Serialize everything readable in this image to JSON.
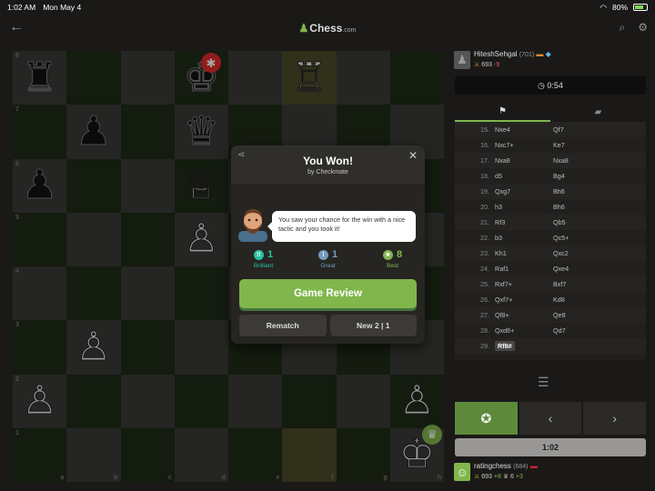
{
  "status_bar": {
    "time": "1:02 AM",
    "date": "Mon May 4",
    "battery": "80%"
  },
  "app": {
    "logo_main": "Chess",
    "logo_suffix": ".com"
  },
  "board": {
    "pieces": [
      [
        "♜",
        "",
        "",
        "♚",
        "",
        "♖",
        "",
        ""
      ],
      [
        "",
        "♟",
        "",
        "♛",
        "",
        "",
        "",
        ""
      ],
      [
        "♟",
        "",
        "",
        "♕",
        "",
        "",
        "",
        ""
      ],
      [
        "",
        "",
        "",
        "♙",
        "",
        "",
        "",
        ""
      ],
      [
        "",
        "",
        "",
        "",
        "",
        "",
        "",
        ""
      ],
      [
        "",
        "♙",
        "",
        "",
        "",
        "",
        "",
        ""
      ],
      [
        "♙",
        "",
        "",
        "",
        "",
        "",
        "",
        "♙"
      ],
      [
        "",
        "",
        "",
        "",
        "",
        "",
        "",
        "♔"
      ]
    ],
    "rank_labels": [
      "8",
      "7",
      "6",
      "5",
      "4",
      "3",
      "2",
      "1"
    ],
    "file_labels": [
      "a",
      "b",
      "c",
      "d",
      "e",
      "f",
      "g",
      "h"
    ]
  },
  "modal": {
    "title": "You Won!",
    "subtitle": "by Checkmate",
    "coach_message": "You saw your chance for the win with a nice tactic and you took it!",
    "stats": [
      {
        "icon": "!!",
        "value": "1",
        "label": "Brilliant",
        "color": "#26c2a3"
      },
      {
        "icon": "!",
        "value": "1",
        "label": "Great",
        "color": "#749bbf"
      },
      {
        "icon": "★",
        "value": "8",
        "label": "Best",
        "color": "#81b64c"
      }
    ],
    "review_button": "Game Review",
    "rematch_button": "Rematch",
    "new_game_button": "New 2 | 1"
  },
  "opponent": {
    "name": "HiteshSehgal",
    "rating": "(701)",
    "points": "693",
    "delta": "-9",
    "clock": "0:54"
  },
  "me": {
    "name": "ratingchess",
    "rating": "(684)",
    "points": "693",
    "delta": "+8",
    "trophies": "6",
    "trophy_delta": "+3",
    "clock": "1:02"
  },
  "moves": [
    {
      "n": "15.",
      "w": "Nxe4",
      "b": "Qf7"
    },
    {
      "n": "16.",
      "w": "Nxc7+",
      "b": "Ke7"
    },
    {
      "n": "17.",
      "w": "Nxa8",
      "b": "Nxa8"
    },
    {
      "n": "18.",
      "w": "d5",
      "b": "Bg4"
    },
    {
      "n": "19.",
      "w": "Qxg7",
      "b": "Bh6"
    },
    {
      "n": "20.",
      "w": "h3",
      "b": "Bh6"
    },
    {
      "n": "21.",
      "w": "Rf3",
      "b": "Qb5"
    },
    {
      "n": "22.",
      "w": "b3",
      "b": "Qc5+"
    },
    {
      "n": "23.",
      "w": "Kh1",
      "b": "Qxc2"
    },
    {
      "n": "24.",
      "w": "Raf1",
      "b": "Qxe4"
    },
    {
      "n": "25.",
      "w": "Rxf7+",
      "b": "Bxf7"
    },
    {
      "n": "26.",
      "w": "Qxf7+",
      "b": "Kd8"
    },
    {
      "n": "27.",
      "w": "Qf8+",
      "b": "Qe8"
    },
    {
      "n": "28.",
      "w": "Qxd6+",
      "b": "Qd7"
    },
    {
      "n": "29.",
      "w": "Rf8#",
      "b": ""
    }
  ]
}
